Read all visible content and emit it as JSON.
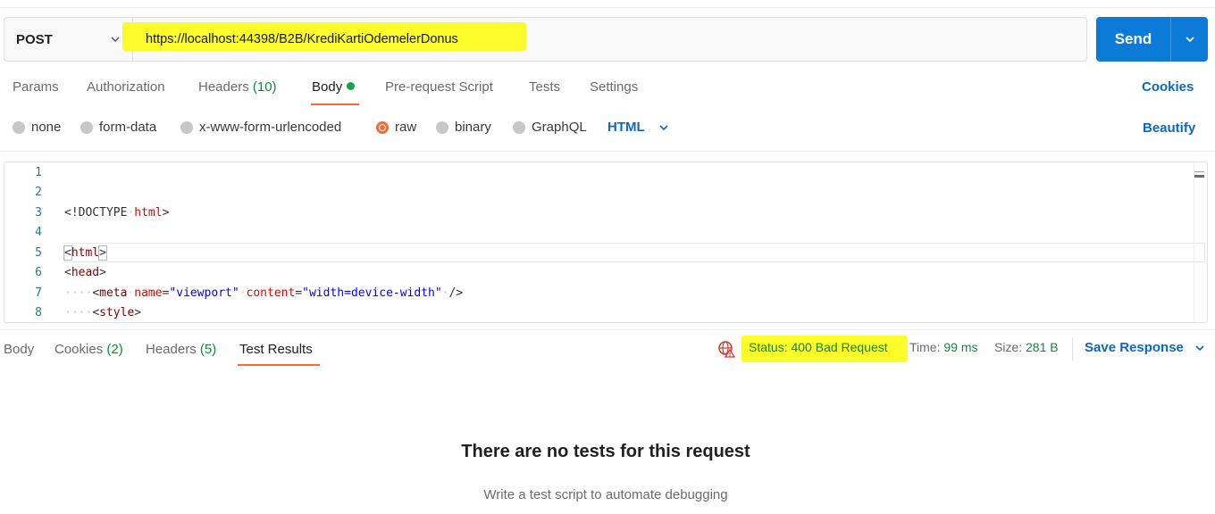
{
  "request": {
    "method": "POST",
    "url": "https://localhost:44398/B2B/KrediKartiOdemelerDonus",
    "send_label": "Send"
  },
  "request_tabs": {
    "params": "Params",
    "authorization": "Authorization",
    "headers_label": "Headers",
    "headers_count": "(10)",
    "body": "Body",
    "pre_request": "Pre-request Script",
    "tests": "Tests",
    "settings": "Settings",
    "cookies": "Cookies"
  },
  "body_types": {
    "none": "none",
    "form_data": "form-data",
    "urlencoded": "x-www-form-urlencoded",
    "raw": "raw",
    "binary": "binary",
    "graphql": "GraphQL",
    "selected": "raw",
    "language": "HTML",
    "beautify": "Beautify"
  },
  "editor": {
    "lines": [
      {
        "n": "1"
      },
      {
        "n": "2"
      },
      {
        "n": "3",
        "doctype": "<!DOCTYPE",
        "doctype_name": "html",
        "close": ">"
      },
      {
        "n": "4"
      },
      {
        "n": "5",
        "open": "<",
        "tag": "html",
        "close": ">"
      },
      {
        "n": "6",
        "open": "<",
        "tag": "head",
        "close": ">"
      },
      {
        "n": "7",
        "indent": "····",
        "open": "<",
        "tag": "meta",
        "attr1": "name",
        "eq1": "=",
        "val1": "\"viewport\"",
        "attr2": "content",
        "eq2": "=",
        "val2": "\"width=device-width\"",
        "close": "/>"
      },
      {
        "n": "8",
        "indent": "····",
        "open": "<",
        "tag": "style",
        "close": ">"
      }
    ]
  },
  "response": {
    "tabs": {
      "body": "Body",
      "cookies_label": "Cookies",
      "cookies_count": "(2)",
      "headers_label": "Headers",
      "headers_count": "(5)",
      "test_results": "Test Results"
    },
    "status_label": "Status:",
    "status_value": "400 Bad Request",
    "time_label": "Time:",
    "time_value": "99 ms",
    "size_label": "Size:",
    "size_value": "281 B",
    "save_response": "Save Response",
    "empty_title": "There are no tests for this request",
    "empty_subtitle": "Write a test script to automate debugging"
  },
  "colors": {
    "accent_orange": "#f26b3a",
    "send_blue": "#0c7bd8",
    "link_blue": "#0c68c4",
    "success_green": "#10893e",
    "highlight_yellow": "#fcfc2a"
  },
  "icons": {
    "method_dropdown": "chevron-down-icon",
    "send_dropdown": "chevron-down-icon",
    "language_dropdown": "chevron-down-icon",
    "network": "globe-warning-icon",
    "save_response_dropdown": "chevron-down-icon"
  }
}
